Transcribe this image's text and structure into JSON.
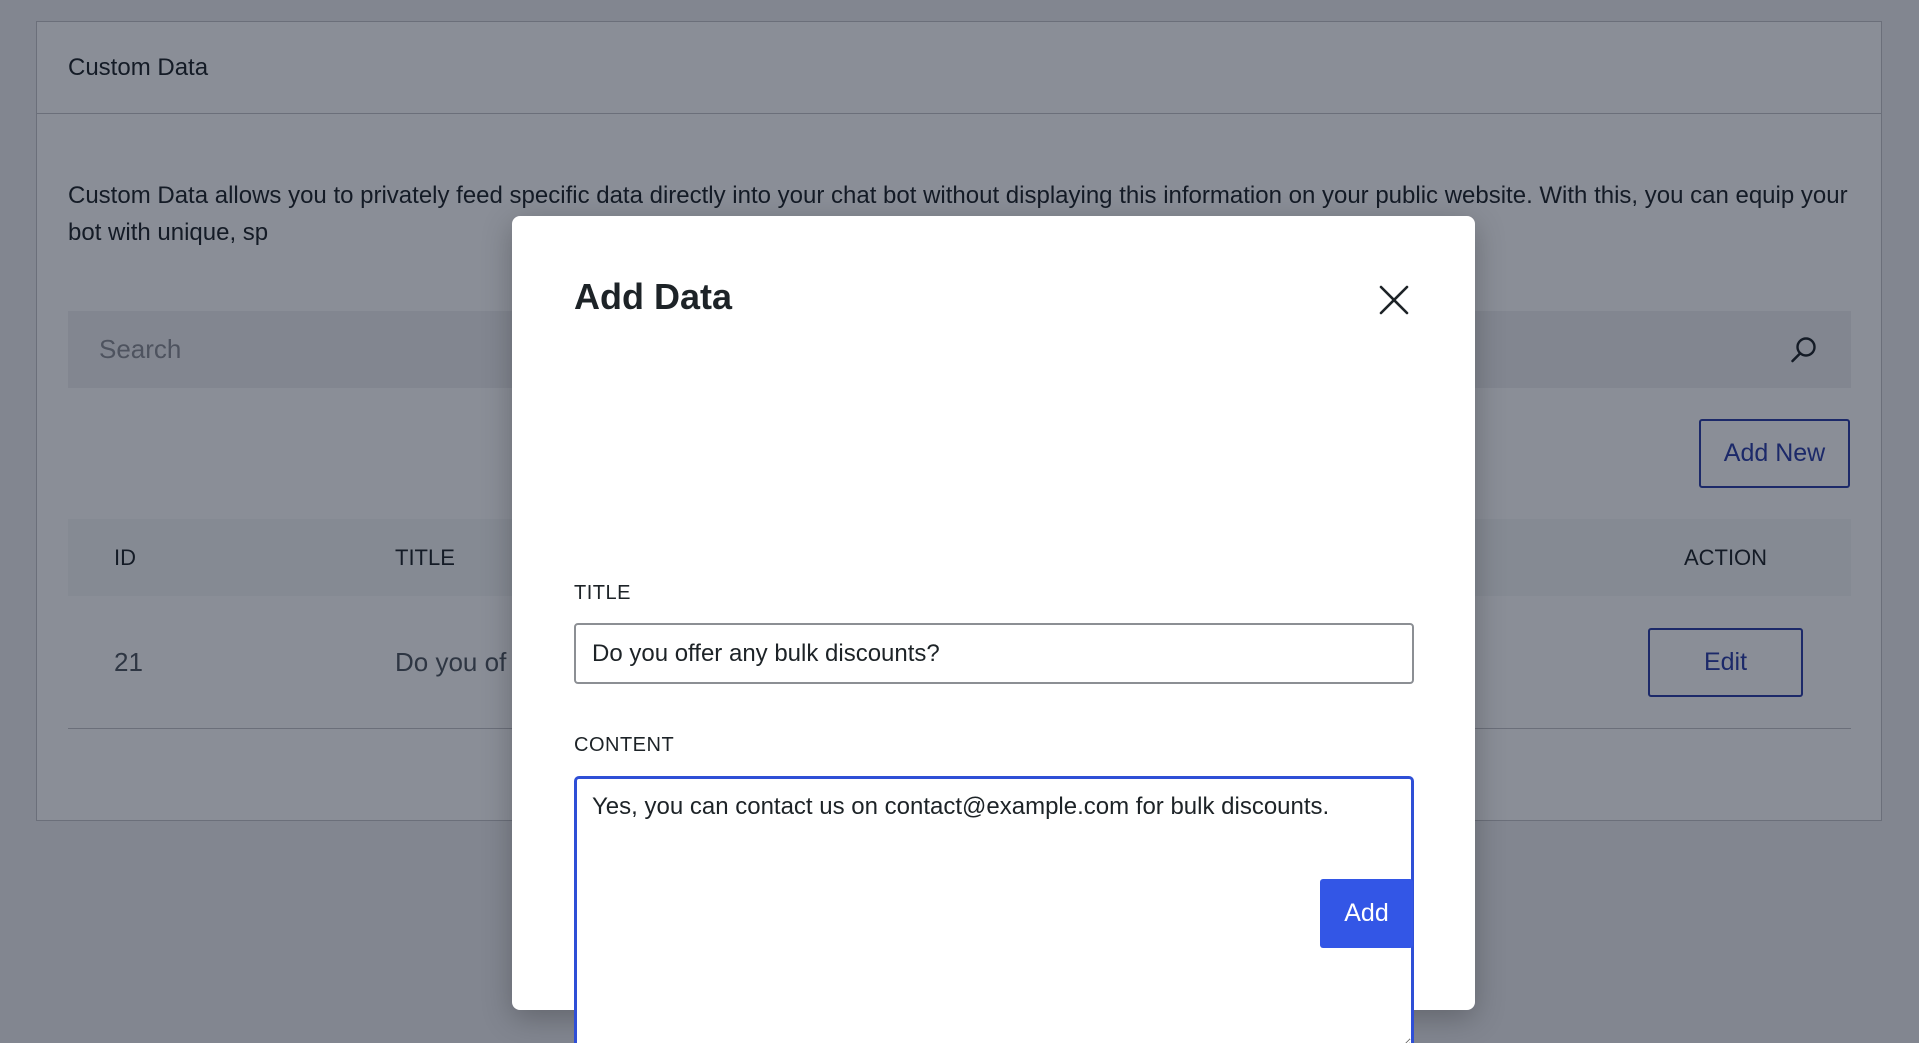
{
  "page": {
    "panel_title": "Custom Data",
    "description": "Custom Data allows you to privately feed specific data directly into your chat bot without displaying this information on your public website. With this, you can equip your bot with unique, sp",
    "search": {
      "placeholder": "Search",
      "icon": "search-icon"
    },
    "add_new_label": "Add New",
    "table": {
      "headers": {
        "id": "ID",
        "title": "TITLE",
        "action": "ACTION"
      },
      "rows": [
        {
          "id": "21",
          "title": "Do you of",
          "action_label": "Edit"
        }
      ]
    }
  },
  "modal": {
    "title": "Add Data",
    "close_icon": "close-icon",
    "title_label": "TITLE",
    "title_value": "Do you offer any bulk discounts?",
    "content_label": "CONTENT",
    "content_value": "Yes, you can contact us on contact@example.com for bulk discounts.",
    "submit_label": "Add"
  },
  "colors": {
    "accent": "#3356e6",
    "outline_button": "#2c3fa8",
    "focus_border": "#2f4fd6",
    "overlay": "rgba(10, 18, 38, 0.48)"
  }
}
